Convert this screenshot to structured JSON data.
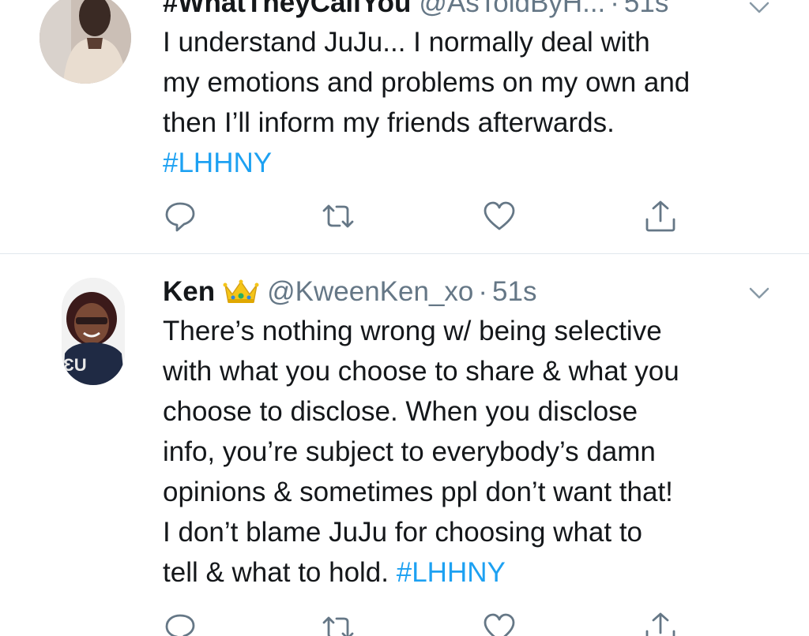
{
  "tweets": [
    {
      "name": "#WhatTheyCallYou",
      "handle": "@AsToldByH...",
      "dot": "·",
      "time": "51s",
      "text_lines": [
        "I understand JuJu... I normally deal with",
        "my emotions and problems on my own and",
        "then I’ll inform my friends afterwards."
      ],
      "hashtag": "#LHHNY"
    },
    {
      "name": "Ken",
      "handle": "@KweenKen_xo",
      "dot": "·",
      "time": "51s",
      "text_lines": [
        "There’s nothing wrong w/ being selective",
        "with what you choose to share & what you",
        "choose to disclose. When you disclose",
        "info, you’re subject to everybody’s damn",
        "opinions & sometimes ppl don’t want that!",
        "I don’t blame JuJu for choosing what to",
        "tell & what to hold."
      ],
      "hashtag": "#LHHNY"
    }
  ],
  "icons": {
    "reply": "reply-icon",
    "retweet": "retweet-icon",
    "like": "heart-icon",
    "share": "share-icon",
    "menu": "chevron-down-icon",
    "crown": "crown-emoji"
  },
  "colors": {
    "hashtag": "#1da1f2",
    "muted": "#657786",
    "divider": "#e1e8ed",
    "text": "#14171a"
  }
}
